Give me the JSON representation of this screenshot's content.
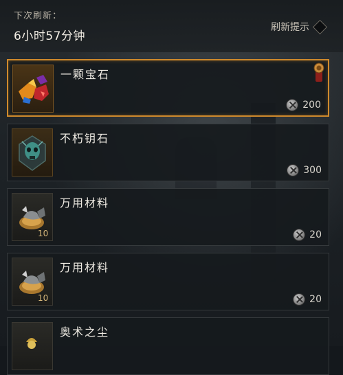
{
  "header": {
    "refresh_caption": "下次刷新：",
    "refresh_time": "6小时57分钟",
    "hint_label": "刷新提示"
  },
  "items": [
    {
      "name": "一颗宝石",
      "price": "200",
      "count": "",
      "icon": "gem-icon",
      "selected": true
    },
    {
      "name": "不朽钥石",
      "price": "300",
      "count": "",
      "icon": "key-stone-icon",
      "selected": false
    },
    {
      "name": "万用材料",
      "price": "20",
      "count": "10",
      "icon": "material-icon",
      "selected": false
    },
    {
      "name": "万用材料",
      "price": "20",
      "count": "10",
      "icon": "material-icon",
      "selected": false
    },
    {
      "name": "奥术之尘",
      "price": "",
      "count": "",
      "icon": "arcane-dust-icon",
      "selected": false
    }
  ],
  "colors": {
    "selected_border": "#d08a2c",
    "card_bg": "#161a1d",
    "text": "#f0ece4"
  }
}
